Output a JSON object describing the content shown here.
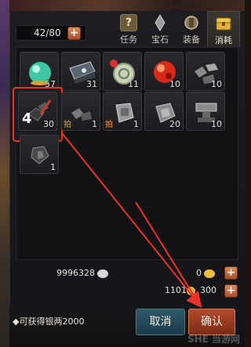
{
  "inventory": {
    "capacity": "42/80",
    "tabs": [
      {
        "label": "任务",
        "icon": "question-scroll-icon"
      },
      {
        "label": "宝石",
        "icon": "gem-icon"
      },
      {
        "label": "装备",
        "icon": "armor-icon"
      },
      {
        "label": "消耗",
        "icon": "chest-icon"
      }
    ],
    "active_tab": "消耗",
    "items": [
      {
        "name": "jade-orb",
        "count": "57",
        "bound": ""
      },
      {
        "name": "iron-chest",
        "count": "31",
        "bound": ""
      },
      {
        "name": "jade-pendant",
        "count": "11",
        "bound": ""
      },
      {
        "name": "fire-orb",
        "count": "10",
        "bound": ""
      },
      {
        "name": "ore-pile",
        "count": "10",
        "bound": ""
      },
      {
        "name": "black-ore",
        "count": "30",
        "bound": ""
      },
      {
        "name": "ore-chunk",
        "count": "1",
        "bound": "拍"
      },
      {
        "name": "silver-ore",
        "count": "1",
        "bound": "拍"
      },
      {
        "name": "silver-stone",
        "count": "20",
        "bound": ""
      },
      {
        "name": "anvil",
        "count": "10",
        "bound": ""
      },
      {
        "name": "rough-stone",
        "count": "1",
        "bound": ""
      }
    ],
    "selected_quantity": "4"
  },
  "currency": {
    "silver": "9996328",
    "gold": "0",
    "points": "1101",
    "points2": "300"
  },
  "footer": {
    "reward": "◆可获得银两2000",
    "cancel": "取消",
    "confirm": "确认",
    "watermark": "SHE 当游网"
  },
  "colors": {
    "highlight": "#e8322a",
    "accent": "#d98a5a"
  }
}
